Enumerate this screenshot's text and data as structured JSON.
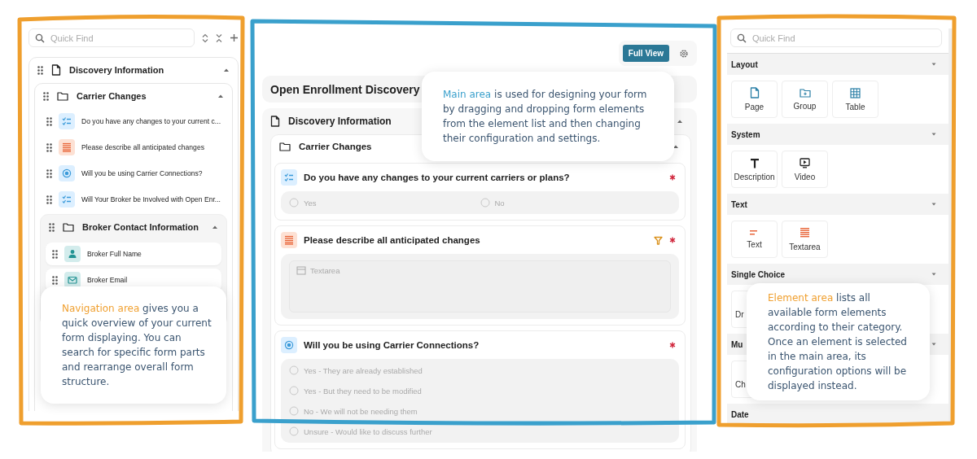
{
  "navigation": {
    "search": {
      "placeholder": "Quick Find"
    },
    "tree": [
      {
        "label": "Discovery Information",
        "kind": "page",
        "expanded": true,
        "children": [
          {
            "label": "Carrier Changes",
            "kind": "group",
            "expanded": true,
            "children": [
              {
                "label": "Do you have any changes to your current c...",
                "kind": "checklist"
              },
              {
                "label": "Please describe all anticipated changes",
                "kind": "textarea"
              },
              {
                "label": "Will you be using Carrier Connections?",
                "kind": "radio"
              },
              {
                "label": "Will Your Broker be Involved with Open Enr...",
                "kind": "checklist"
              },
              {
                "label": "Broker Contact Information",
                "kind": "group",
                "expanded": true,
                "children": [
                  {
                    "label": "Broker Full Name",
                    "kind": "person"
                  },
                  {
                    "label": "Broker Email",
                    "kind": "mail"
                  }
                ]
              }
            ]
          }
        ]
      }
    ]
  },
  "main": {
    "full_view_button": "Full View",
    "form_title": "Open Enrollment Discovery",
    "page": {
      "title": "Discovery Information",
      "expanded": true,
      "group": {
        "title": "Carrier Changes",
        "expanded": true,
        "questions": [
          {
            "kind": "checklist",
            "title": "Do you have any changes to your current carriers or plans?",
            "required": true,
            "filter": false,
            "options": [
              {
                "label": "Yes",
                "checked": false
              },
              {
                "label": "No",
                "checked": false
              }
            ]
          },
          {
            "kind": "textarea",
            "title": "Please describe all anticipated changes",
            "required": true,
            "filter": true,
            "placeholder": "Textarea"
          },
          {
            "kind": "radio",
            "title": "Will you be using Carrier Connections?",
            "required": true,
            "filter": false,
            "options": [
              {
                "label": "Yes - They are already established",
                "checked": false
              },
              {
                "label": "Yes - But they need to be modified",
                "checked": false
              },
              {
                "label": "No - We will not be needing them",
                "checked": false
              },
              {
                "label": "Unsure - Would like to discuss further",
                "checked": false
              }
            ]
          }
        ]
      }
    }
  },
  "elements": {
    "search": {
      "placeholder": "Quick Find"
    },
    "categories": [
      {
        "title": "Layout",
        "expanded": true,
        "items": [
          {
            "label": "Page",
            "kind": "page"
          },
          {
            "label": "Group",
            "kind": "folder-plus"
          },
          {
            "label": "Table",
            "kind": "grid"
          }
        ]
      },
      {
        "title": "System",
        "expanded": true,
        "items": [
          {
            "label": "Description",
            "kind": "letter"
          },
          {
            "label": "Video",
            "kind": "video"
          }
        ]
      },
      {
        "title": "Text",
        "expanded": true,
        "items": [
          {
            "label": "Text",
            "kind": "short-text"
          },
          {
            "label": "Textarea",
            "kind": "textarea"
          }
        ]
      },
      {
        "title": "Single Choice",
        "expanded": true,
        "items": [
          {
            "label": "Dr",
            "kind": "none"
          }
        ]
      },
      {
        "title": "Mu",
        "expanded": true,
        "items": [
          {
            "label": "Ch",
            "kind": "none"
          }
        ]
      },
      {
        "title": "Date"
      }
    ]
  },
  "callouts": [
    {
      "kind": "navigation",
      "text": "**Navigation area** gives you a quick overview of your current form displaying. You can search for specific form parts and rearrange overall form structure."
    },
    {
      "kind": "main",
      "text": "**Main area** is used for designing your form by dragging and dropping form elements from the element list and then changing their configuration and settings."
    },
    {
      "kind": "element",
      "text": "**Element area** lists all available form elements according to their category. Once an element is selected in the main area, its configuration options will be displayed instead."
    }
  ]
}
